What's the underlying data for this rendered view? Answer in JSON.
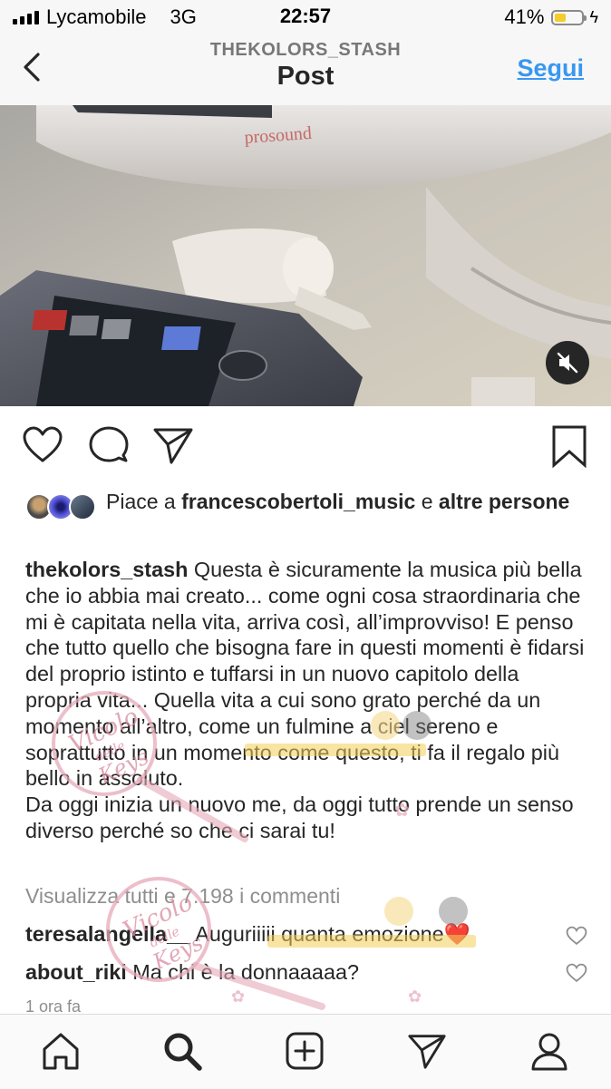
{
  "status": {
    "carrier": "Lycamobile",
    "network": "3G",
    "time": "22:57",
    "battery": "41%",
    "battery_level": 0.41
  },
  "nav": {
    "subtitle": "THEKOLORS_STASH",
    "title": "Post",
    "follow_label": "Segui"
  },
  "likes": {
    "prefix": "Piace a",
    "user": "francescobertoli_music",
    "conj": "e",
    "rest": "altre persone"
  },
  "caption": {
    "username": "thekolors_stash",
    "paragraph1": "Questa è sicuramente la musica più bella che io abbia mai creato... come ogni cosa straordinaria che mi è capitata nella vita, arriva così, all’improvviso! E penso che tutto quello che bisogna fare in questi momenti è fidarsi del proprio istinto e tuffarsi in un nuovo capitolo della propria vita... Quella vita a cui sono grato perché da un momento all’altro, come un fulmine a ciel sereno e soprattutto in un momento come questo, ti fa il regalo più bello in assoluto.",
    "paragraph2": "Da oggi inizia un nuovo me, da oggi tutto prende un senso diverso perché so che ci sarai tu!"
  },
  "view_all_comments": "Visualizza tutti e 7.198 i commenti",
  "comments": [
    {
      "user": "teresalangella__",
      "text": "Auguriiiii quanta emozione❤️"
    },
    {
      "user": "about_riki",
      "text": "Ma chi è la donnaaaaa?"
    }
  ],
  "time_ago": "1 ora fa",
  "media": {
    "brand": "prosound"
  },
  "watermark": {
    "text1": "Vicolo",
    "text2": "delle",
    "text3": "Keys"
  },
  "colors": {
    "link": "#3897f0",
    "text": "#262626",
    "muted": "#8e8e8e",
    "battery": "#f5cc2a"
  },
  "icons": {
    "back": "chevron-left-icon",
    "like": "heart-icon",
    "comment": "comment-bubble-icon",
    "share": "paper-plane-icon",
    "save": "bookmark-icon",
    "mute": "speaker-muted-icon",
    "home": "home-icon",
    "search": "search-icon",
    "new_post": "plus-square-icon",
    "direct": "paper-plane-icon",
    "profile": "profile-icon"
  }
}
